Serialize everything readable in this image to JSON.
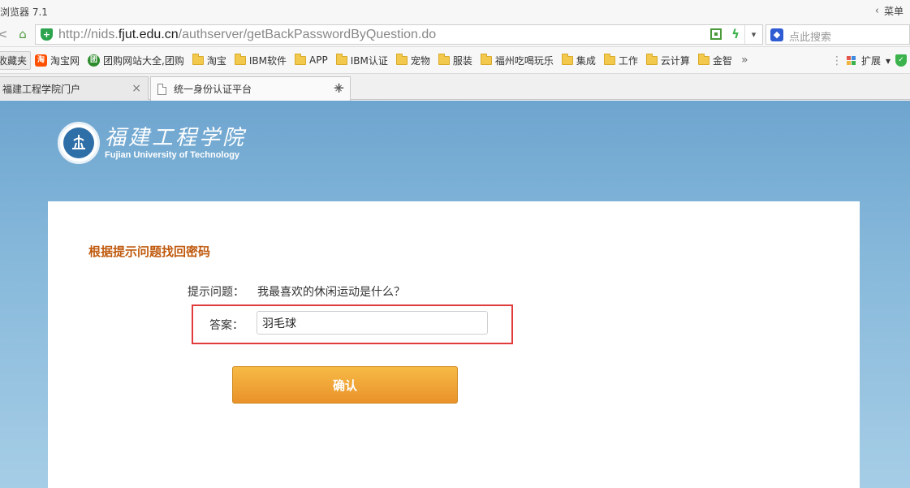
{
  "browser": {
    "title": "浏览器 7.1",
    "menu_label": "菜单",
    "url_prefix": "http://nids.",
    "url_domain": "fjut.edu.cn",
    "url_path": "/authserver/getBackPasswordByQuestion.do",
    "search_placeholder": "点此搜索"
  },
  "bookmarks": {
    "items": [
      "收藏夹",
      "淘宝网",
      "团购网站大全,团购",
      "淘宝",
      "IBM软件",
      "APP",
      "IBM认证",
      "宠物",
      "服装",
      "福州吃喝玩乐",
      "集成",
      "工作",
      "云计算",
      "金智"
    ],
    "more": "»",
    "extensions_label": "扩展"
  },
  "tabs": [
    {
      "label": "福建工程学院门户"
    },
    {
      "label": "统一身份认证平台"
    }
  ],
  "page": {
    "school_name_cn": "福建工程学院",
    "school_name_en": "Fujian University of Technology",
    "heading": "根据提示问题找回密码",
    "question_label": "提示问题：",
    "question_text": "我最喜欢的休闲运动是什么？",
    "answer_label": "答案：",
    "answer_value": "羽毛球",
    "confirm_label": "确认"
  },
  "colors": {
    "heading": "#c05a0e",
    "highlight_border": "#e23b3b",
    "button": "#eea032",
    "background": "#86b8da"
  }
}
